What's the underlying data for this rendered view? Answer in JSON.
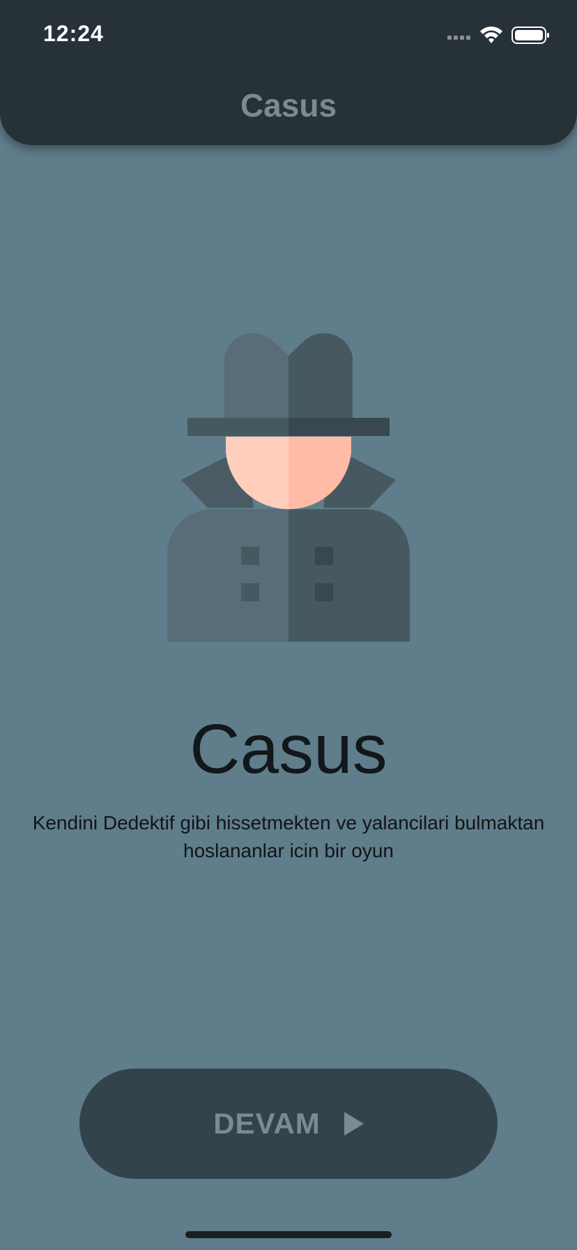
{
  "status_bar": {
    "time": "12:24",
    "icons": [
      "cellular-signal-icon",
      "wifi-icon",
      "battery-icon"
    ]
  },
  "app_bar": {
    "title": "Casus"
  },
  "hero": {
    "illustration": "spy-detective-icon",
    "title": "Casus",
    "description": "Kendini Dedektif gibi hissetmekten ve yalancilari bulmaktan hoslananlar icin bir oyun"
  },
  "actions": {
    "continue_label": "DEVAM",
    "continue_icon": "play-arrow-icon"
  },
  "colors": {
    "background": "#607d8b",
    "app_bar": "#263238",
    "button": "#33434b",
    "muted_text": "#7c8a92"
  }
}
